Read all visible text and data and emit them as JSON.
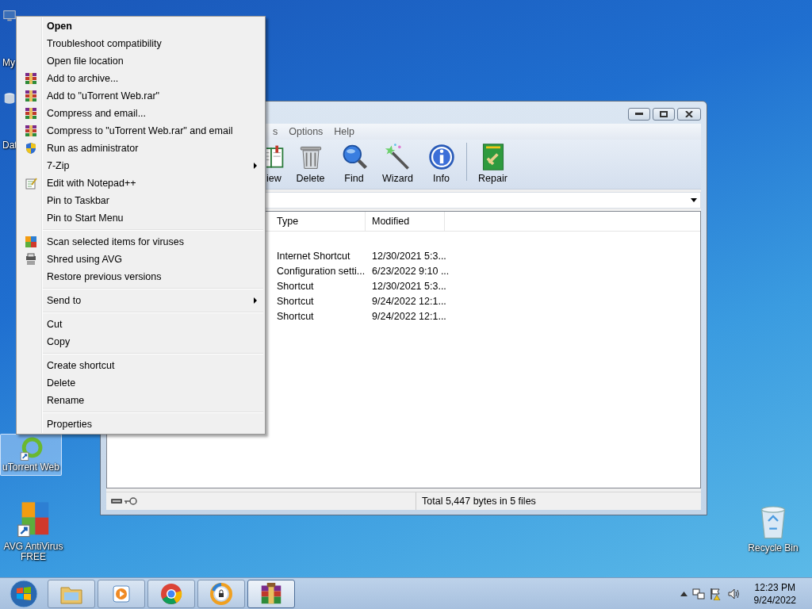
{
  "desktop_icons": [
    {
      "kind": "computer",
      "label": "My",
      "selected": false
    },
    {
      "kind": "database",
      "label": "Dat",
      "selected": false
    },
    {
      "kind": "utorrent",
      "label": "uTorrent Web",
      "selected": true
    },
    {
      "kind": "avg",
      "label": "AVG AntiVirus FREE",
      "selected": false
    },
    {
      "kind": "recycle",
      "label": "Recycle Bin",
      "selected": false
    }
  ],
  "context_menu": {
    "groups": [
      [
        {
          "label": "Open",
          "kind": "plain",
          "default": true,
          "submenu": false
        },
        {
          "label": "Troubleshoot compatibility",
          "kind": "plain",
          "default": false,
          "submenu": false
        },
        {
          "label": "Open file location",
          "kind": "plain",
          "default": false,
          "submenu": false
        },
        {
          "label": "Add to archive...",
          "kind": "rar",
          "default": false,
          "submenu": false
        },
        {
          "label": "Add to \"uTorrent Web.rar\"",
          "kind": "rar",
          "default": false,
          "submenu": false
        },
        {
          "label": "Compress and email...",
          "kind": "rar",
          "default": false,
          "submenu": false
        },
        {
          "label": "Compress to \"uTorrent Web.rar\" and email",
          "kind": "rar",
          "default": false,
          "submenu": false
        },
        {
          "label": "Run as administrator",
          "kind": "shield",
          "default": false,
          "submenu": false
        },
        {
          "label": "7-Zip",
          "kind": "plain",
          "default": false,
          "submenu": true
        },
        {
          "label": "Edit with Notepad++",
          "kind": "notepad",
          "default": false,
          "submenu": false
        },
        {
          "label": "Pin to Taskbar",
          "kind": "plain",
          "default": false,
          "submenu": false
        },
        {
          "label": "Pin to Start Menu",
          "kind": "plain",
          "default": false,
          "submenu": false
        }
      ],
      [
        {
          "label": "Scan selected items for viruses",
          "kind": "avg",
          "default": false,
          "submenu": false
        },
        {
          "label": "Shred using AVG",
          "kind": "shredder",
          "default": false,
          "submenu": false
        },
        {
          "label": "Restore previous versions",
          "kind": "plain",
          "default": false,
          "submenu": false
        }
      ],
      [
        {
          "label": "Send to",
          "kind": "plain",
          "default": false,
          "submenu": true
        }
      ],
      [
        {
          "label": "Cut",
          "kind": "plain",
          "default": false,
          "submenu": false
        },
        {
          "label": "Copy",
          "kind": "plain",
          "default": false,
          "submenu": false
        }
      ],
      [
        {
          "label": "Create shortcut",
          "kind": "plain",
          "default": false,
          "submenu": false
        },
        {
          "label": "Delete",
          "kind": "plain",
          "default": false,
          "submenu": false
        },
        {
          "label": "Rename",
          "kind": "plain",
          "default": false,
          "submenu": false
        }
      ],
      [
        {
          "label": "Properties",
          "kind": "plain",
          "default": false,
          "submenu": false
        }
      ]
    ]
  },
  "archiver_window": {
    "menu": [
      "s",
      "Options",
      "Help"
    ],
    "toolbar": {
      "groups": [
        [
          {
            "kind": "book",
            "label": "iew"
          },
          {
            "kind": "trash",
            "label": "Delete"
          },
          {
            "kind": "magnifier",
            "label": "Find"
          },
          {
            "kind": "wand",
            "label": "Wizard"
          },
          {
            "kind": "info",
            "label": "Info"
          }
        ],
        [
          {
            "kind": "repair",
            "label": "Repair"
          }
        ]
      ]
    },
    "table": {
      "columns": [
        "Type",
        "Modified"
      ],
      "rows": [
        {
          "type": "Internet Shortcut",
          "modified": "12/30/2021 5:3..."
        },
        {
          "type": "Configuration setti...",
          "modified": "6/23/2022 9:10 ..."
        },
        {
          "type": "Shortcut",
          "modified": "12/30/2021 5:3..."
        },
        {
          "type": "Shortcut",
          "modified": "9/24/2022 12:1..."
        },
        {
          "type": "Shortcut",
          "modified": "9/24/2022 12:1..."
        }
      ]
    },
    "status_bar": "Total 5,447 bytes in 5 files"
  },
  "taskbar": {
    "apps": [
      {
        "kind": "folder",
        "selected": false
      },
      {
        "kind": "player",
        "selected": false
      },
      {
        "kind": "chrome",
        "selected": false
      },
      {
        "kind": "secure-browser",
        "selected": false
      },
      {
        "kind": "rar",
        "selected": true
      }
    ],
    "clock": {
      "time": "12:23 PM",
      "date": "9/24/2022"
    }
  }
}
